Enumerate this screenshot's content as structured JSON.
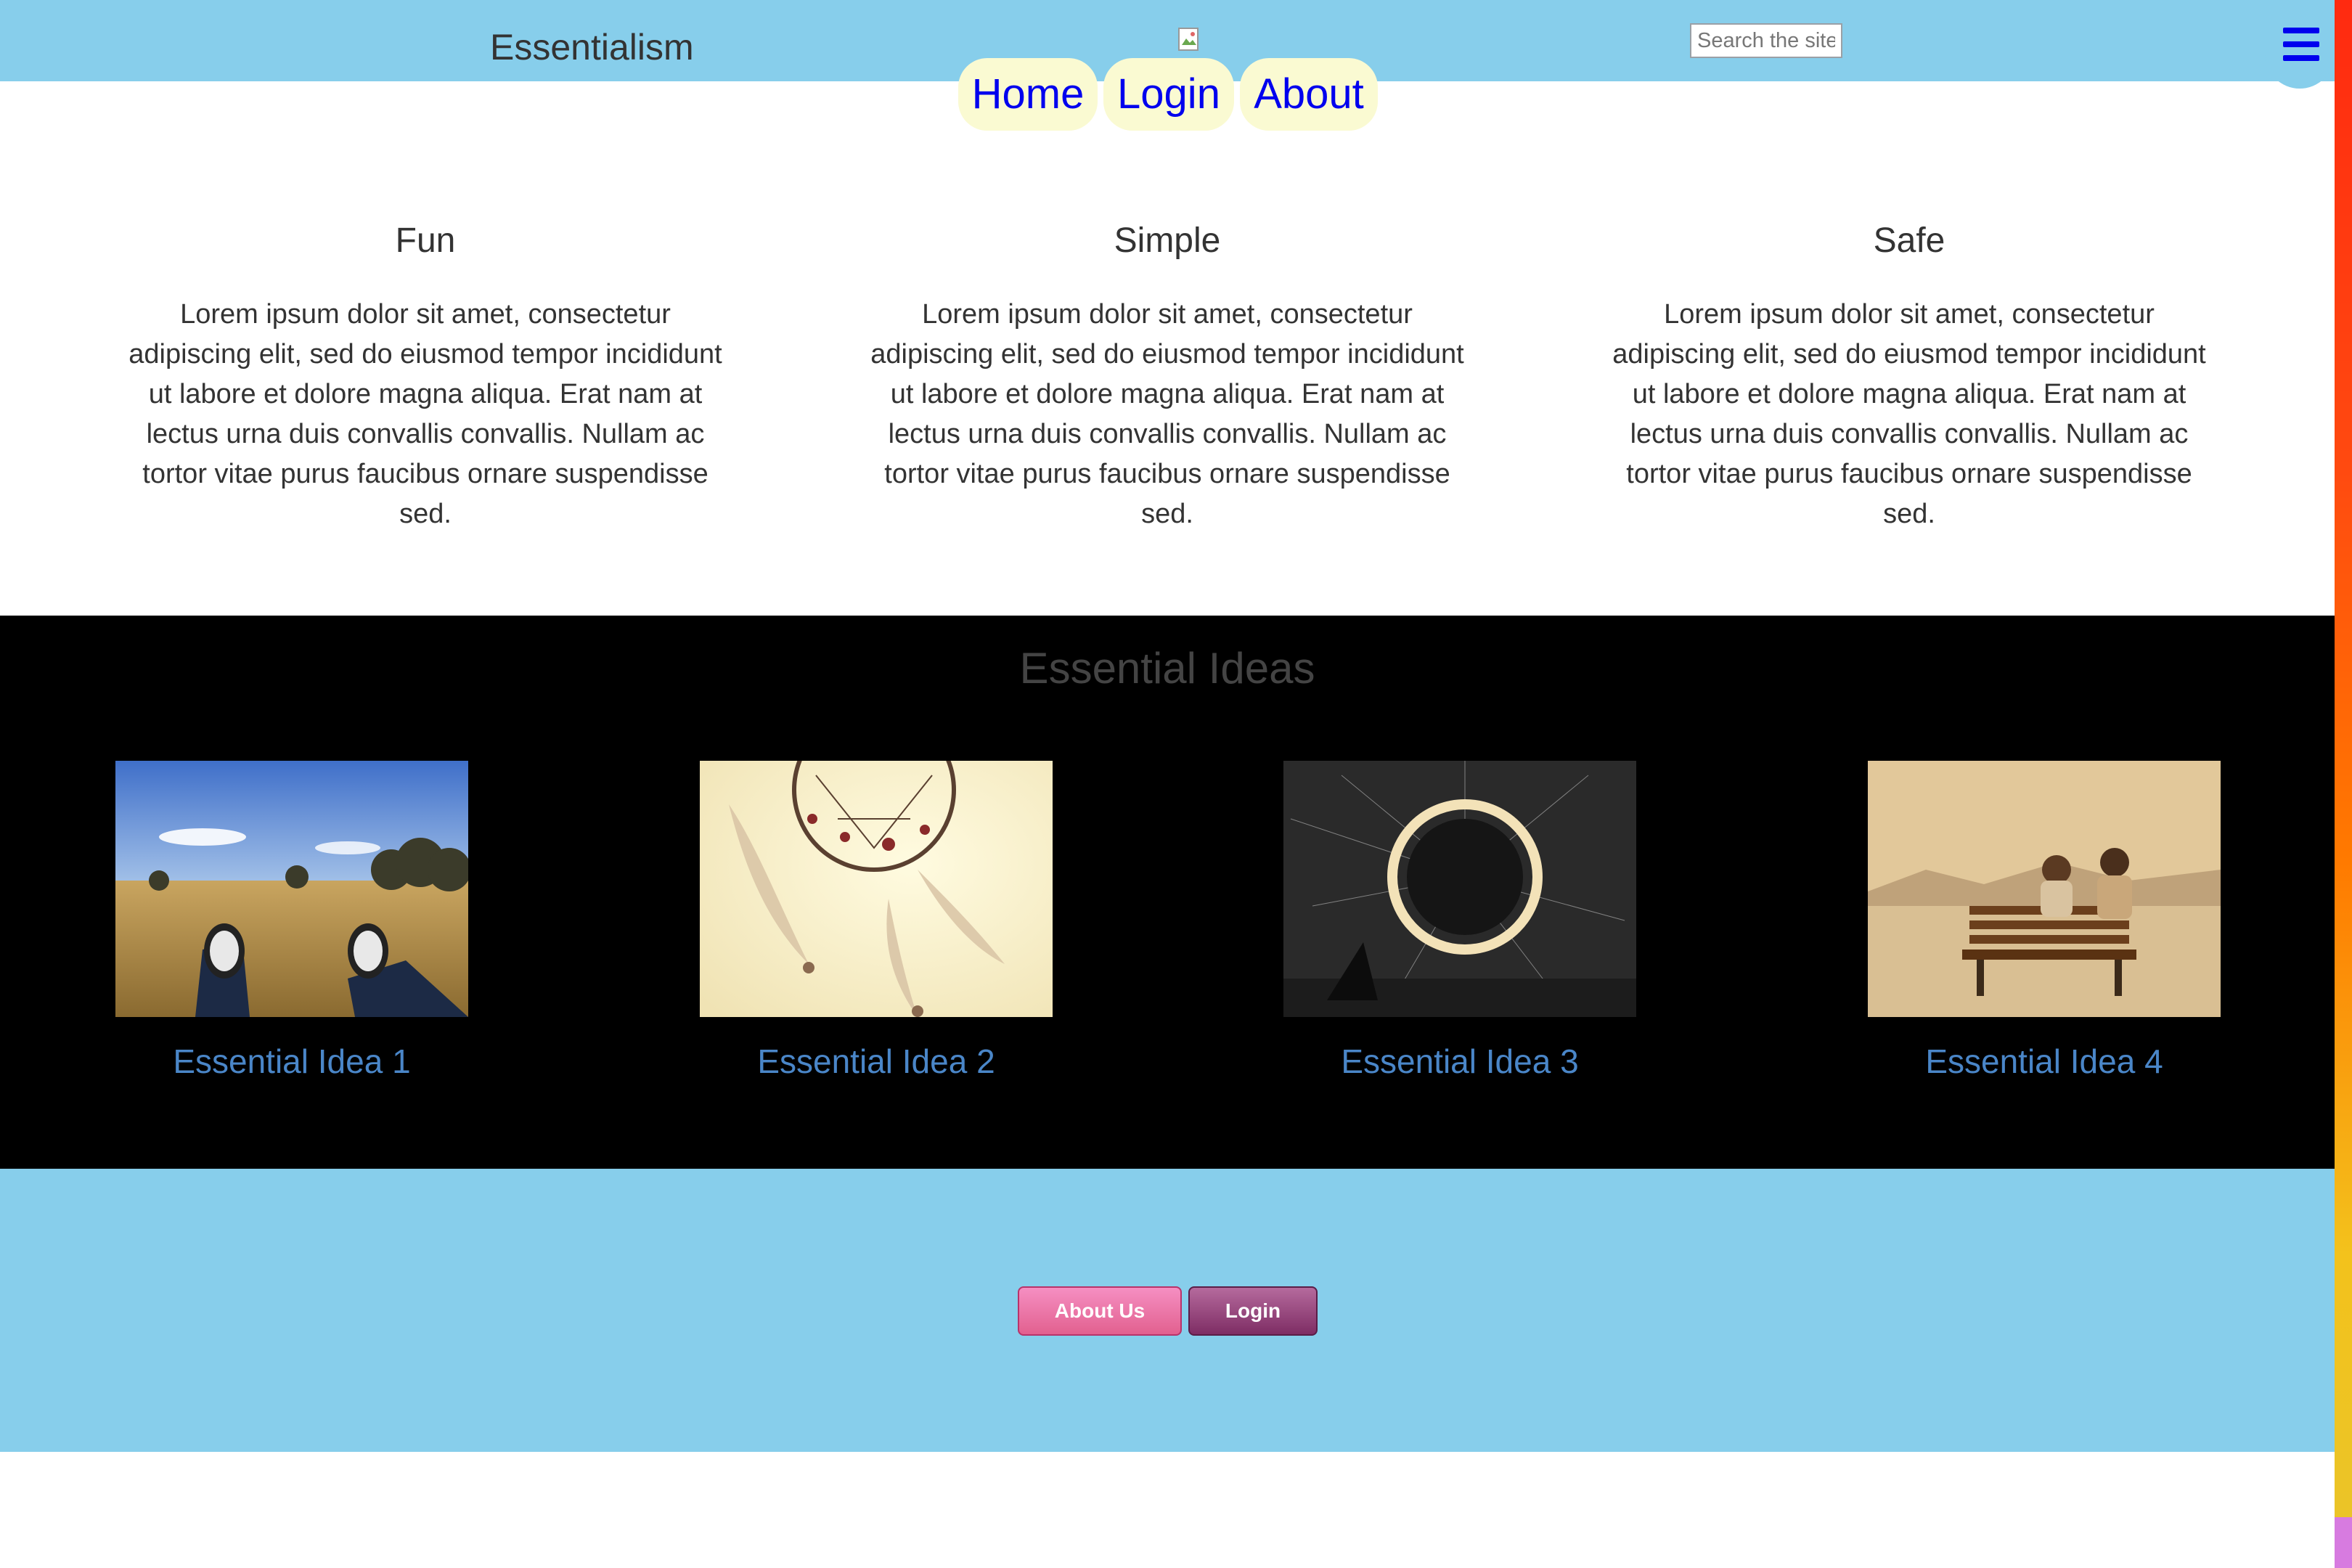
{
  "header": {
    "site_title": "Essentialism",
    "search_placeholder": "Search the site",
    "menu_icon": "hamburger-menu-icon"
  },
  "nav": {
    "items": [
      {
        "label": "Home"
      },
      {
        "label": "Login"
      },
      {
        "label": "About"
      }
    ]
  },
  "features": [
    {
      "title": "Fun",
      "text": "Lorem ipsum dolor sit amet, consectetur adipiscing elit, sed do eiusmod tempor incididunt ut labore et dolore magna aliqua. Erat nam at lectus urna duis convallis convallis. Nullam ac tortor vitae purus faucibus ornare suspendisse sed."
    },
    {
      "title": "Simple",
      "text": "Lorem ipsum dolor sit amet, consectetur adipiscing elit, sed do eiusmod tempor incididunt ut labore et dolore magna aliqua. Erat nam at lectus urna duis convallis convallis. Nullam ac tortor vitae purus faucibus ornare suspendisse sed."
    },
    {
      "title": "Safe",
      "text": "Lorem ipsum dolor sit amet, consectetur adipiscing elit, sed do eiusmod tempor incididunt ut labore et dolore magna aliqua. Erat nam at lectus urna duis convallis convallis. Nullam ac tortor vitae purus faucibus ornare suspendisse sed."
    }
  ],
  "ideas": {
    "title": "Essential Ideas",
    "items": [
      {
        "label": "Essential Idea 1",
        "image": "sneakers-on-grass-photo"
      },
      {
        "label": "Essential Idea 2",
        "image": "dreamcatcher-photo"
      },
      {
        "label": "Essential Idea 3",
        "image": "steel-wool-light-ring-photo"
      },
      {
        "label": "Essential Idea 4",
        "image": "couple-on-bench-photo"
      }
    ]
  },
  "footer": {
    "about_us_label": "About Us",
    "login_label": "Login"
  },
  "colors": {
    "header_bg": "#87ceeb",
    "nav_pill_bg": "#fafad2",
    "nav_link": "#0000ee",
    "ideas_bg": "#000000",
    "idea_link": "#4a86c8"
  }
}
